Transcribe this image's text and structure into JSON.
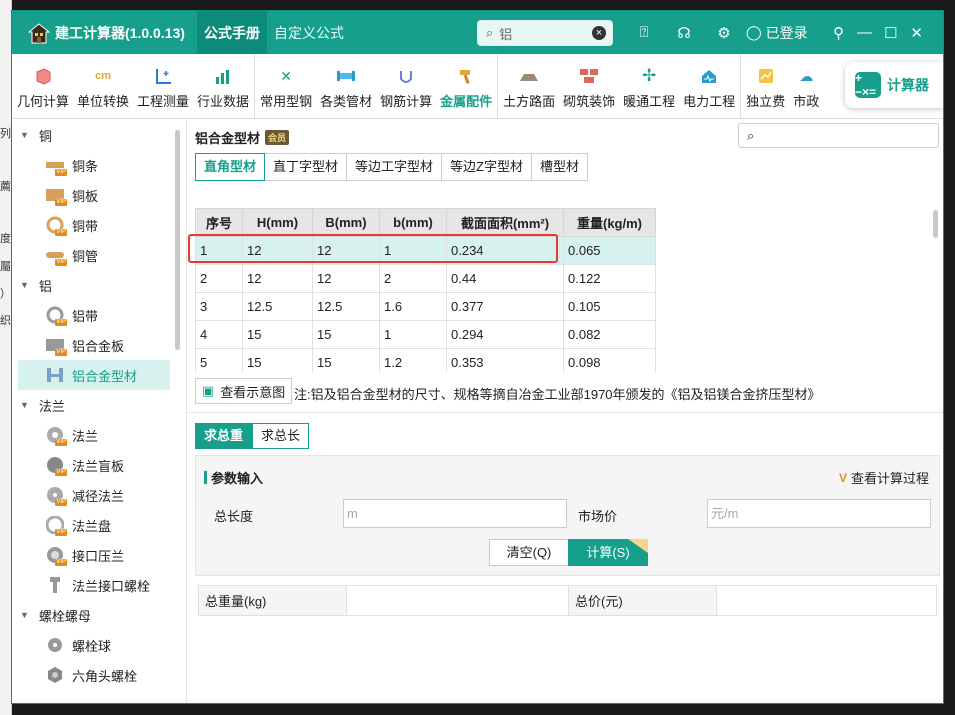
{
  "app": {
    "title": "建工计算器(1.0.0.13)",
    "tabs": [
      "公式手册",
      "自定义公式"
    ],
    "search_value": "铝",
    "login": "已登录"
  },
  "bg_chars": [
    "列",
    "薦",
    "度",
    "屬",
    "）",
    "织"
  ],
  "toolbar": {
    "groups": [
      [
        "几何计算",
        "单位转换",
        "工程测量",
        "行业数据"
      ],
      [
        "常用型钢",
        "各类管材",
        "钢筋计算",
        "金属配件"
      ],
      [
        "土方路面",
        "砌筑装饰",
        "暖通工程",
        "电力工程"
      ],
      [
        "独立费",
        "市政"
      ]
    ],
    "active": "金属配件",
    "calc_button": "计算器",
    "calc_icon": "+−×="
  },
  "sidebar": [
    {
      "cat": "铜",
      "items": [
        "铜条",
        "铜板",
        "铜带",
        "铜管"
      ]
    },
    {
      "cat": "铝",
      "items": [
        "铝带",
        "铝合金板",
        "铝合金型材"
      ]
    },
    {
      "cat": "法兰",
      "items": [
        "法兰",
        "法兰盲板",
        "减径法兰",
        "法兰盘",
        "接口压兰",
        "法兰接口螺栓"
      ]
    },
    {
      "cat": "螺栓螺母",
      "items": [
        "螺栓球",
        "六角头螺栓"
      ]
    }
  ],
  "sidebar_active": "铝合金型材",
  "main": {
    "title": "铝合金型材",
    "badge": "会员",
    "subtabs": [
      "直角型材",
      "直丁字型材",
      "等边工字型材",
      "等边Z字型材",
      "槽型材"
    ],
    "table": {
      "headers": [
        "序号",
        "H(mm)",
        "B(mm)",
        "b(mm)",
        "截面面积(mm²)",
        "重量(kg/m)"
      ],
      "rows": [
        [
          "1",
          "12",
          "12",
          "1",
          "0.234",
          "0.065"
        ],
        [
          "2",
          "12",
          "12",
          "2",
          "0.44",
          "0.122"
        ],
        [
          "3",
          "12.5",
          "12.5",
          "1.6",
          "0.377",
          "0.105"
        ],
        [
          "4",
          "15",
          "15",
          "1",
          "0.294",
          "0.082"
        ],
        [
          "5",
          "15",
          "15",
          "1.2",
          "0.353",
          "0.098"
        ]
      ]
    },
    "view_diagram": "查看示意图",
    "note": "注:铝及铝合金型材的尺寸、规格等摘自冶金工业部1970年颁发的《铝及铝镁合金挤压型材》",
    "calc_tabs": [
      "求总重",
      "求总长"
    ],
    "param": {
      "heading": "参数输入",
      "view_process": "查看计算过程",
      "total_length_label": "总长度",
      "total_length_placeholder": "m",
      "price_label": "市场价",
      "price_placeholder": "元/m",
      "clear": "清空(Q)",
      "calc": "计算(S)"
    },
    "result": {
      "weight_label": "总重量(kg)",
      "price_label": "总价(元)"
    }
  }
}
